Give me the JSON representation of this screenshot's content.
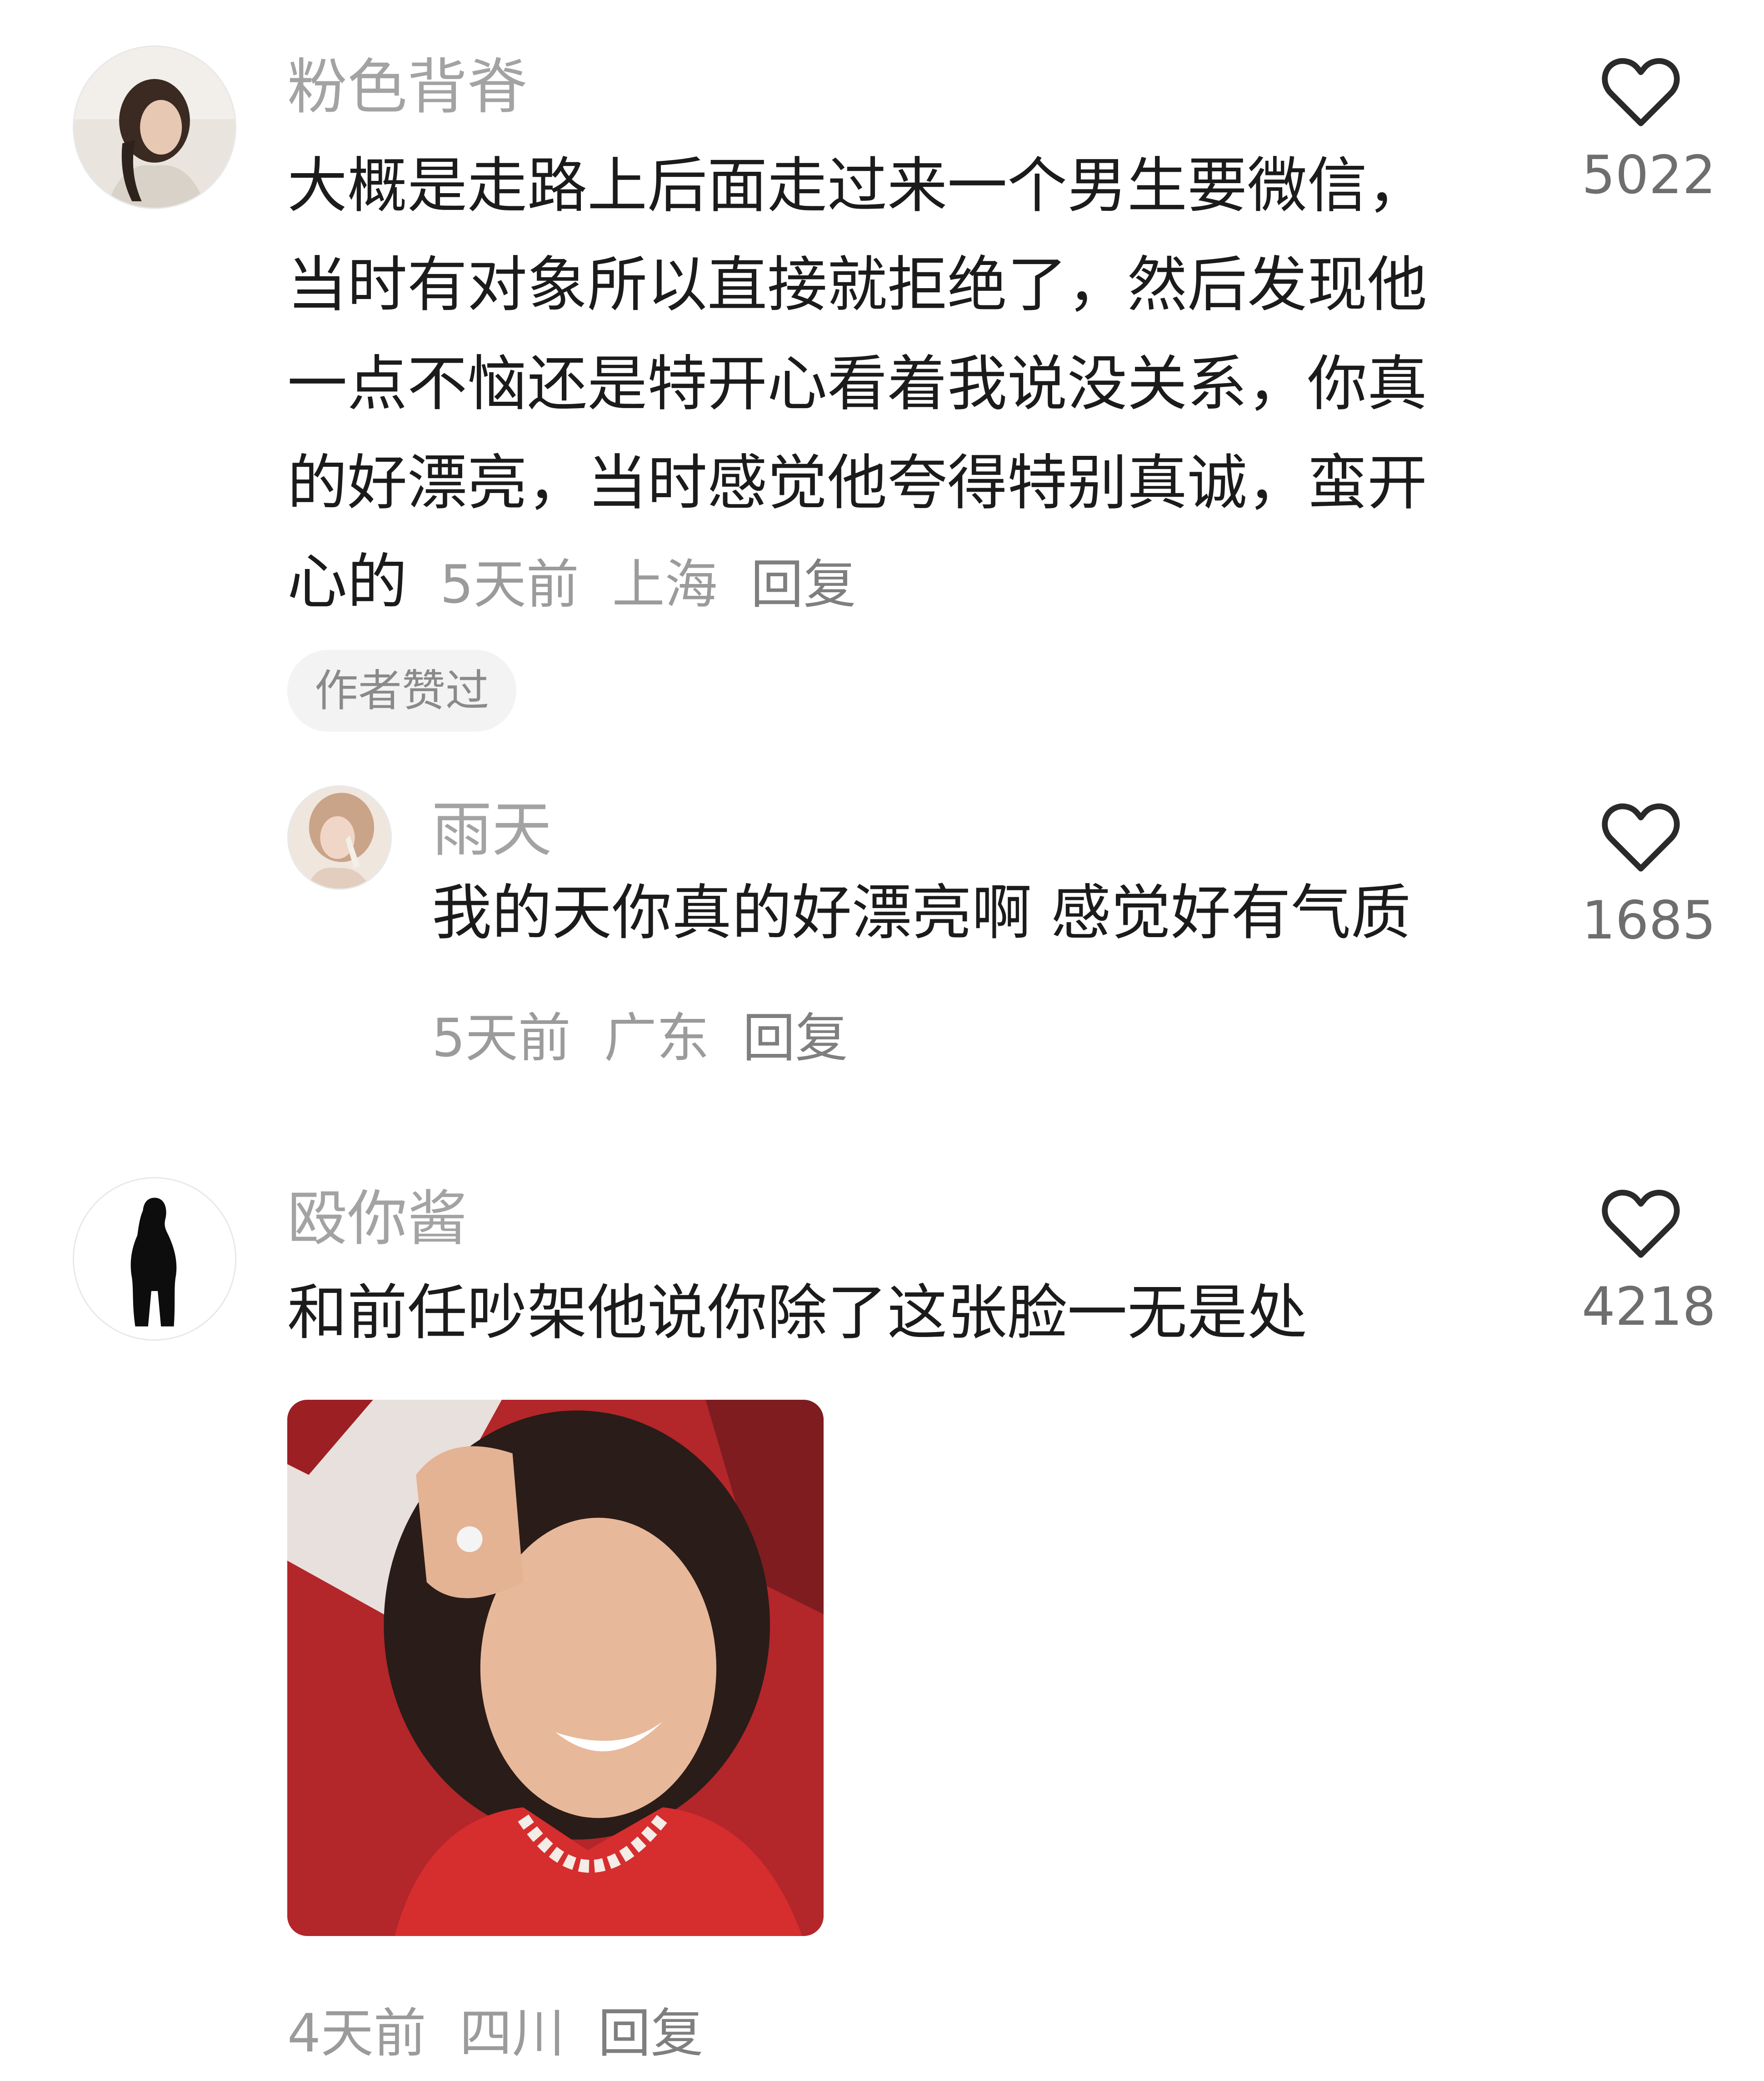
{
  "comments": [
    {
      "username": "粉色背脊",
      "avatar": "woman-photo-avatar",
      "text": "大概是走路上后面走过来一个男生要微信，当时有对象所以直接就拒绝了，然后发现他一点不恼还是特开心看着我说没关系，你真的好漂亮，当时感觉他夸得特别真诚，蛮开心的",
      "time": "5天前",
      "location": "上海",
      "reply_label": "回复",
      "like_icon": "heart-outline-icon",
      "likes": "5022",
      "badge": "作者赞过",
      "replies": [
        {
          "username": "雨天",
          "avatar": "woman-photo-avatar",
          "text": "我的天你真的好漂亮啊 感觉好有气质",
          "time": "5天前",
          "location": "广东",
          "reply_label": "回复",
          "like_icon": "heart-outline-icon",
          "likes": "1685"
        }
      ]
    },
    {
      "username": "殴你酱",
      "avatar": "silhouette-avatar",
      "text": "和前任吵架他说你除了这张脸一无是处",
      "image": "meme-woman-smiling-photo",
      "time": "4天前",
      "location": "四川",
      "reply_label": "回复",
      "like_icon": "heart-outline-icon",
      "likes": "4218"
    }
  ],
  "colors": {
    "text": "#1b1b1b",
    "muted": "#9b9b9b",
    "username": "#a3a3a3",
    "badge_bg": "#f3f3f3",
    "heart": "#2a2a2a"
  }
}
